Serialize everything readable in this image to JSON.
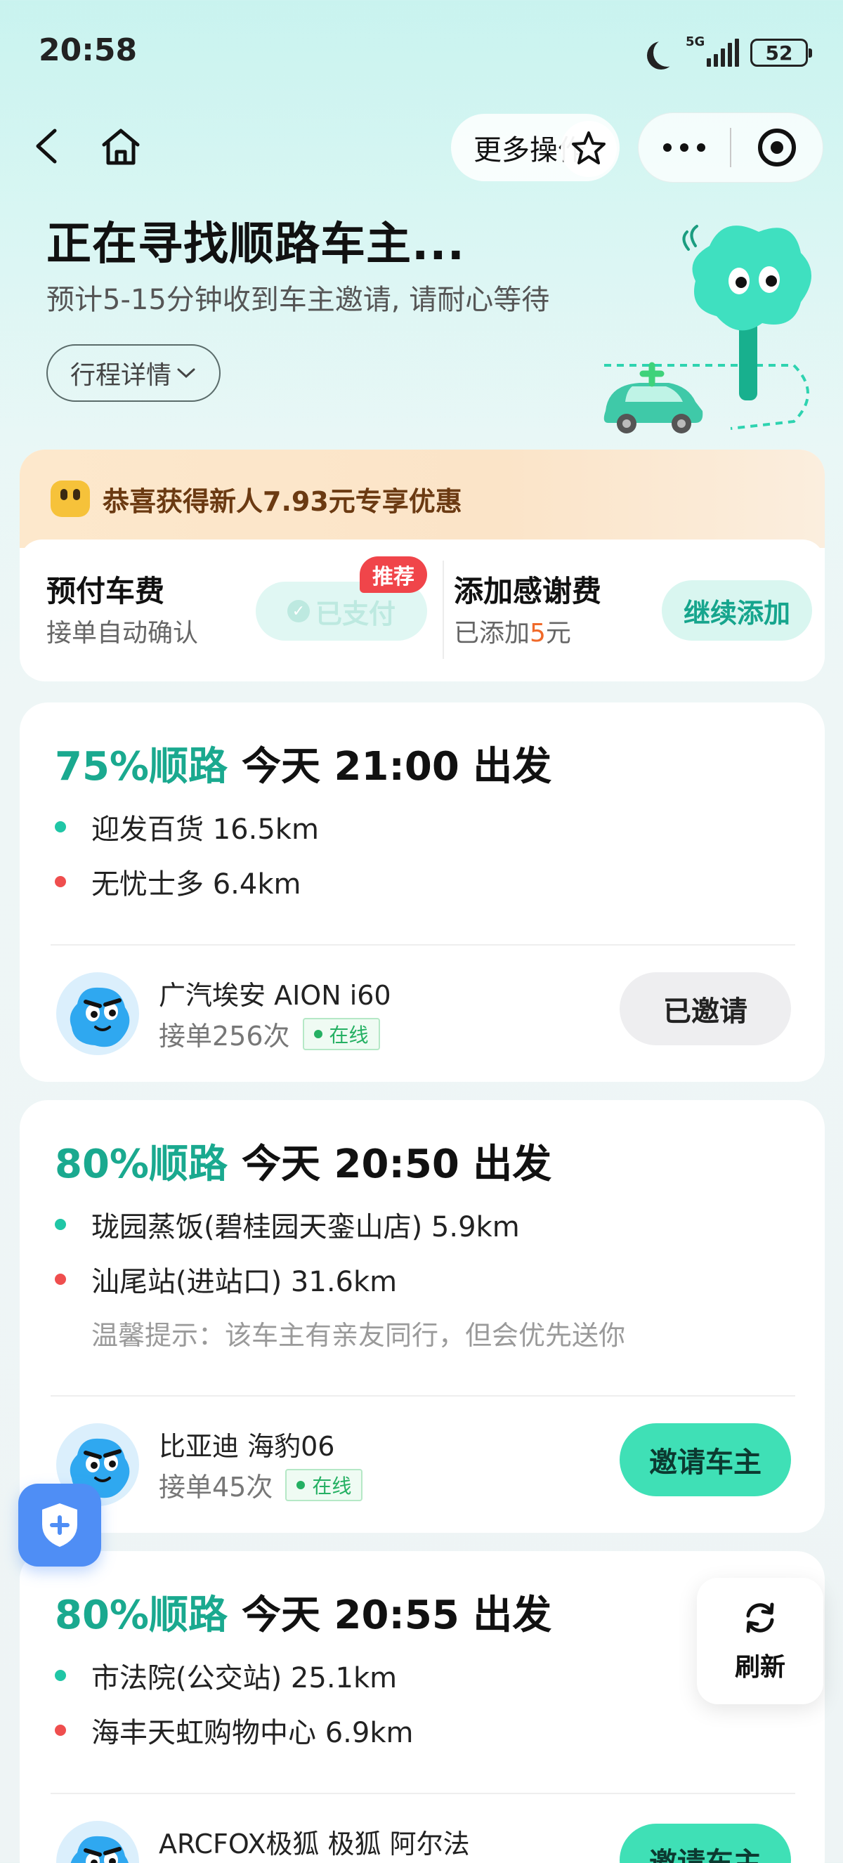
{
  "status_bar": {
    "time": "20:58",
    "network": "5G",
    "battery": "52"
  },
  "nav": {
    "more_ops_label": "更多操作"
  },
  "header": {
    "title": "正在寻找顺路车主...",
    "subtitle": "预计5-15分钟收到车主邀请, 请耐心等待",
    "trip_detail_label": "行程详情"
  },
  "promo": {
    "banner_text": "恭喜获得新人7.93元专享优惠",
    "prepay_title": "预付车费",
    "prepay_sub": "接单自动确认",
    "paid_label": "已支付",
    "recommend_tag": "推荐",
    "tip_title": "添加感谢费",
    "tip_sub_prefix": "已添加",
    "tip_amount": "5",
    "tip_sub_suffix": "元",
    "add_label": "继续添加"
  },
  "rides": [
    {
      "match": "75%顺路",
      "time": "今天 21:00 出发",
      "start": "迎发百货 16.5km",
      "end": "无忧士多 6.4km",
      "car": "广汽埃安 AION i60",
      "orders": "接单256次",
      "online": "在线",
      "action": "已邀请"
    },
    {
      "match": "80%顺路",
      "time": "今天 20:50 出发",
      "start": "珑园蒸饭(碧桂园天銮山店) 5.9km",
      "end": "汕尾站(进站口) 31.6km",
      "note": "温馨提示：该车主有亲友同行，但会优先送你",
      "car": "比亚迪 海豹06",
      "orders": "接单45次",
      "online": "在线",
      "action": "邀请车主"
    },
    {
      "match": "80%顺路",
      "time": "今天 20:55 出发",
      "start": "市法院(公交站) 25.1km",
      "end": "海丰天虹购物中心 6.9km",
      "car": "ARCFOX极狐 极狐 阿尔法",
      "action": "邀请车主"
    }
  ],
  "floating": {
    "refresh_label": "刷新"
  },
  "colors": {
    "accent": "#1aa98f",
    "invite_button": "#3fe0b6",
    "tag_red": "#f0454a",
    "tip_orange": "#f06a2a"
  }
}
